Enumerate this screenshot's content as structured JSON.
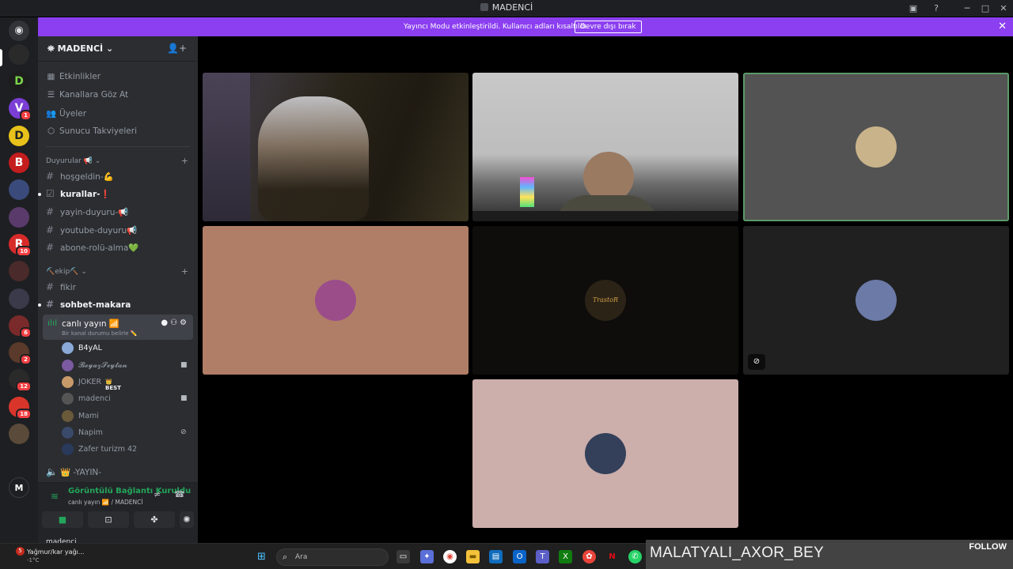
{
  "window": {
    "title": "MADENCİ"
  },
  "banner": {
    "text": "Yayıncı Modu etkinleştirildi. Kullanıcı adları kısaltıldı.",
    "button": "Devre dışı bırak",
    "close": "✕"
  },
  "servers": [
    {
      "initial": "D",
      "badge": ""
    },
    {
      "initial": "",
      "badge": ""
    },
    {
      "initial": "D",
      "badge": ""
    },
    {
      "initial": "V",
      "badge": "1"
    },
    {
      "initial": "D",
      "badge": ""
    },
    {
      "initial": "B",
      "badge": ""
    },
    {
      "initial": "",
      "badge": ""
    },
    {
      "initial": "",
      "badge": ""
    },
    {
      "initial": "R",
      "badge": "10"
    },
    {
      "initial": "",
      "badge": ""
    },
    {
      "initial": "",
      "badge": ""
    },
    {
      "initial": "",
      "badge": "6"
    },
    {
      "initial": "",
      "badge": "2"
    },
    {
      "initial": "",
      "badge": "12"
    },
    {
      "initial": "",
      "badge": "18"
    },
    {
      "initial": "",
      "badge": ""
    },
    {
      "initial": "",
      "badge": ""
    },
    {
      "initial": "M",
      "badge": ""
    }
  ],
  "sidebar": {
    "server_name": "MADENCİ",
    "nav": [
      {
        "label": "Etkinlikler",
        "icon": "calendar-icon"
      },
      {
        "label": "Kanallara Göz At",
        "icon": "browse-icon"
      },
      {
        "label": "Üyeler",
        "icon": "members-icon"
      },
      {
        "label": "Sunucu Takviyeleri",
        "icon": "boost-icon"
      }
    ],
    "categories": [
      {
        "name": "Duyurular 📢",
        "channels": [
          {
            "label": "hoşgeldin-💪",
            "unread": false
          },
          {
            "label": "kurallar-❗",
            "unread": true
          },
          {
            "label": "yayin-duyuru-📢",
            "unread": false
          },
          {
            "label": "youtube-duyuru📢",
            "unread": false
          },
          {
            "label": "abone-rolü-alma💚",
            "unread": false
          }
        ]
      },
      {
        "name": "⛏️ekip⛏️",
        "channels": [
          {
            "label": "fikir",
            "unread": false
          },
          {
            "label": "sohbet-makara",
            "unread": true
          }
        ]
      }
    ],
    "voice_channel": {
      "name": "canlı yayın 📶",
      "status": "Bir kanal durumu belirle ✏️"
    },
    "voice_users": [
      {
        "name": "B4yAL",
        "color": "#8aa9d6",
        "camera": false,
        "muted": false,
        "bright": true
      },
      {
        "name": "𝓑𝓮𝔂𝓪𝔃𝓢𝓮𝔂𝓽𝓪𝓷",
        "color": "#7a5aa0",
        "camera": true,
        "muted": false,
        "bright": false
      },
      {
        "name": "JOKER",
        "tag": "👑 BEST",
        "color": "#c89a6a",
        "camera": false,
        "muted": false,
        "bright": false
      },
      {
        "name": "madenci",
        "color": "#555555",
        "camera": true,
        "muted": false,
        "bright": false
      },
      {
        "name": "Mami",
        "color": "#6a5a3a",
        "camera": false,
        "muted": false,
        "bright": false
      },
      {
        "name": "Napim",
        "color": "#3a4a6a",
        "camera": false,
        "muted": true,
        "bright": false
      },
      {
        "name": "Zafer turizm 42",
        "color": "#2a3a5a",
        "camera": false,
        "muted": false,
        "bright": false
      }
    ],
    "next_channel": "👑 -YAYIN-"
  },
  "voice_panel": {
    "status": "Görüntülü Bağlantı Kuruldu",
    "location": "canlı yayın 📶 / MADENCİ",
    "user": "madenci"
  },
  "video_tiles": [
    {
      "kind": "camera",
      "label": ""
    },
    {
      "kind": "camera",
      "label": ""
    },
    {
      "kind": "avatar",
      "bg": "#535353",
      "avatar_color": "#c9b38a",
      "speaking": true
    },
    {
      "kind": "avatar",
      "bg": "#b07e67",
      "avatar_color": "#9b4d8a"
    },
    {
      "kind": "avatar",
      "bg": "#0e0d0c",
      "avatar_color": "#2b2316",
      "avatar_text": "TrastoR"
    },
    {
      "kind": "avatar",
      "bg": "#202020",
      "avatar_color": "#6c7aa8",
      "muted": true
    },
    {
      "kind": "avatar",
      "bg": "#ccaeab",
      "avatar_color": "#34405a"
    }
  ],
  "taskbar": {
    "weather_badge": "5",
    "weather": "Yağmur/kar yağı...",
    "temp": "-1°C",
    "search_placeholder": "Ara"
  },
  "overlay": {
    "name": "MALATYALI_AXOR_BEY",
    "follow": "FOLLOW"
  }
}
